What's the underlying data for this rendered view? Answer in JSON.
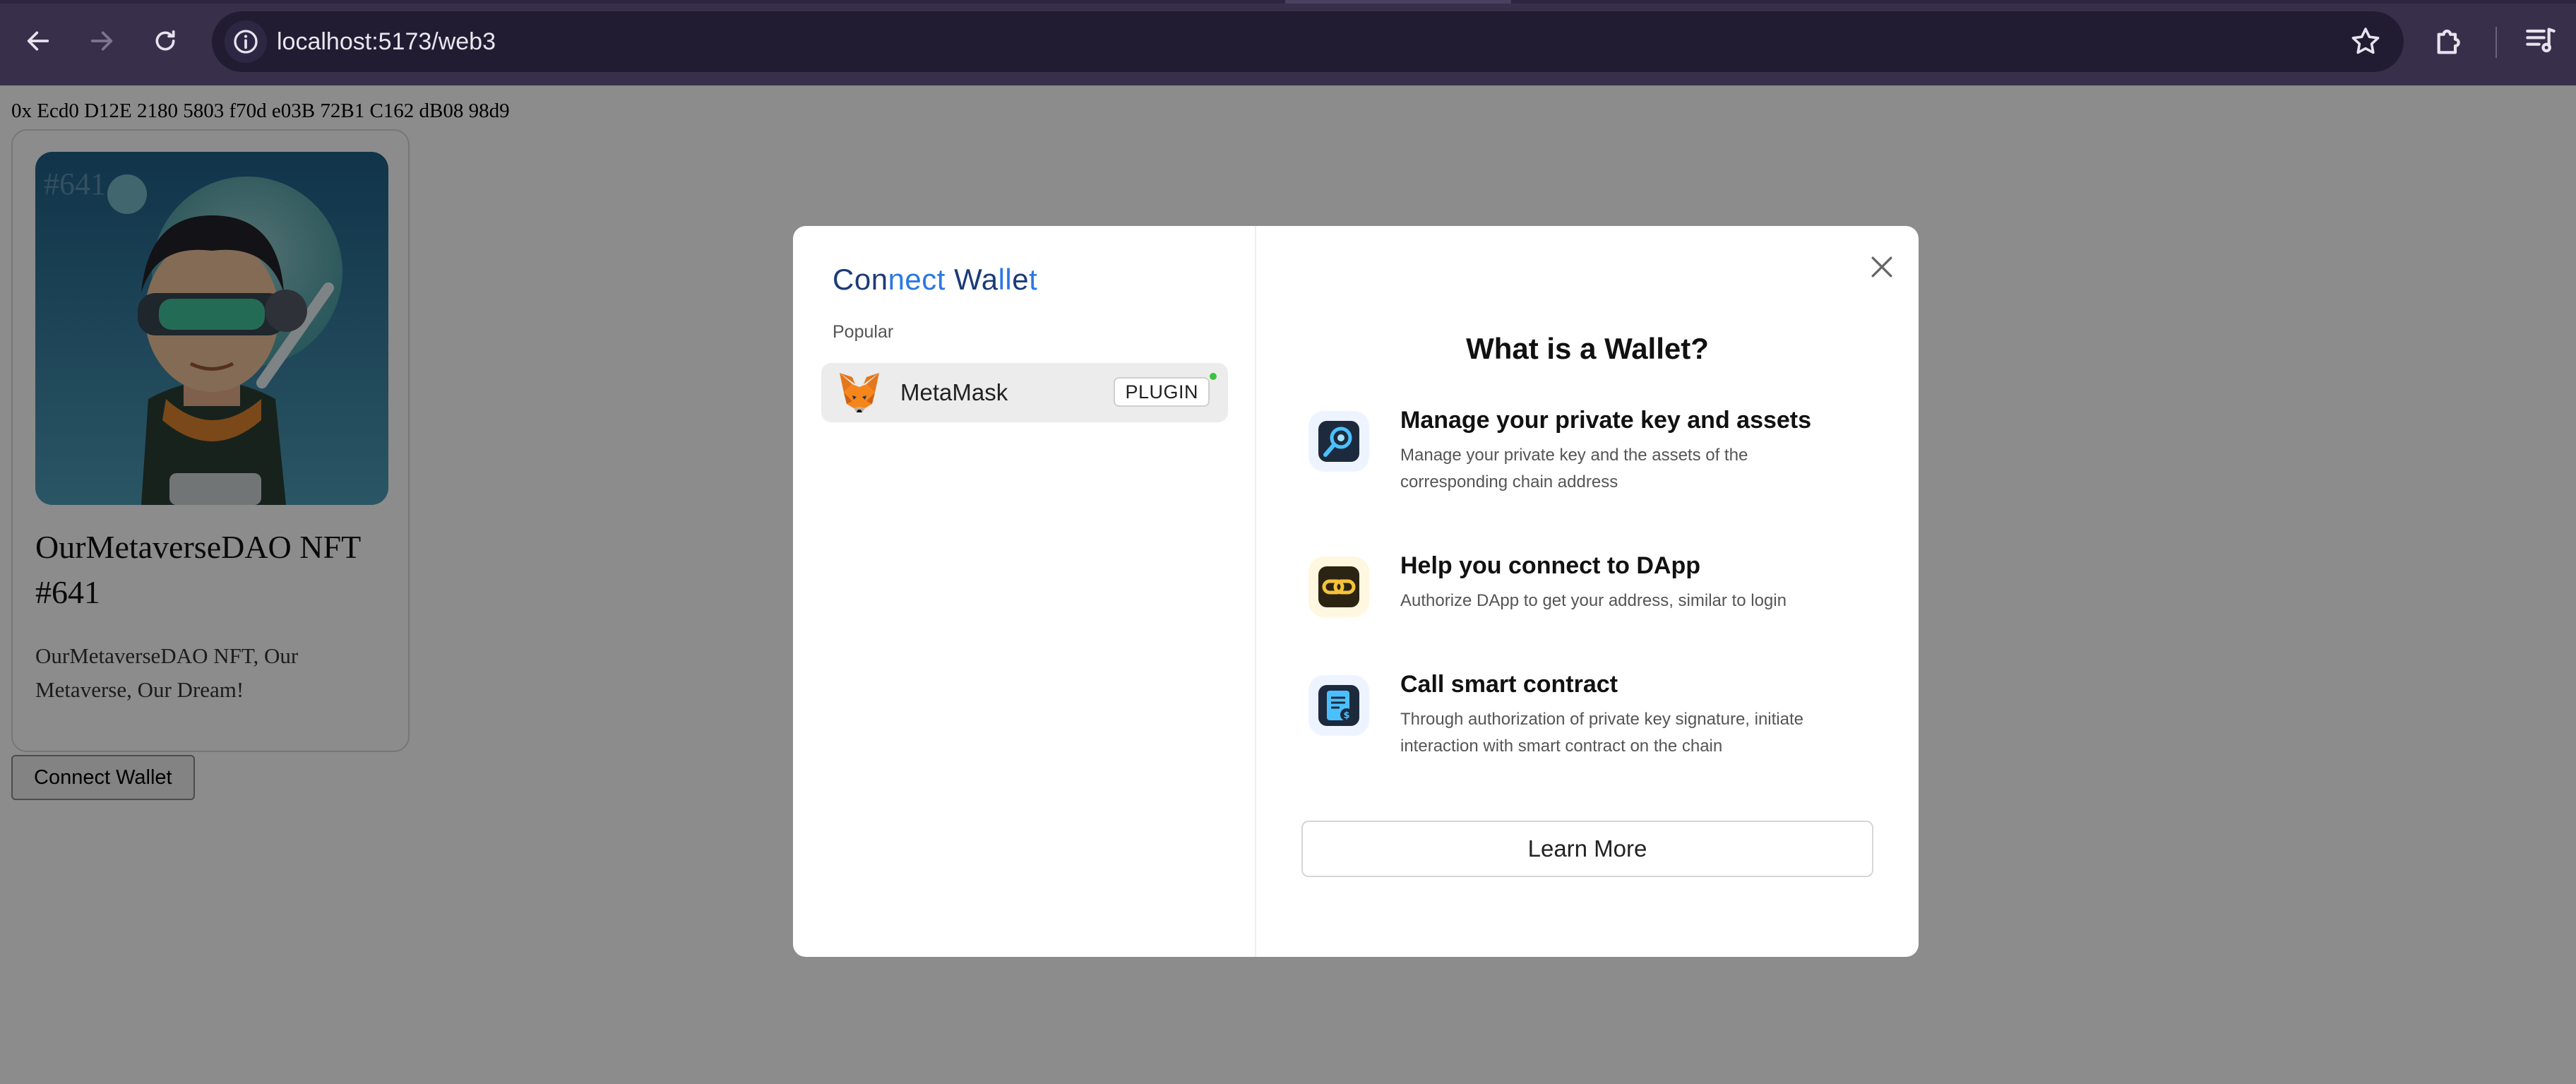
{
  "browser": {
    "url": "localhost:5173/web3",
    "icons": {
      "back": "arrow-left-icon",
      "forward": "arrow-right-icon",
      "reload": "reload-icon",
      "site_info": "site-info-icon",
      "bookmark": "star-icon",
      "extensions": "puzzle-icon",
      "media": "media-controls-icon"
    }
  },
  "page": {
    "address": "0x Ecd0 D12E 2180 5803 f70d e03B 72B1 C162 dB08 98d9",
    "nft": {
      "badge_text": "#641",
      "title": "OurMetaverseDAO NFT #641",
      "description": "OurMetaverseDAO NFT, Our Metaverse, Our Dream!"
    },
    "connect_button": "Connect Wallet"
  },
  "modal": {
    "title_parts": [
      "Con",
      "nect",
      " Wa",
      "ll",
      "e",
      "t"
    ],
    "group_label": "Popular",
    "wallets": [
      {
        "name": "MetaMask",
        "badge": "PLUGIN",
        "status": "online",
        "icon": "metamask-fox-icon"
      }
    ],
    "info_title": "What is a Wallet?",
    "features": [
      {
        "icon": "key-search-icon",
        "title": "Manage your private key and assets",
        "desc": "Manage your private key and the assets of the corresponding chain address"
      },
      {
        "icon": "link-icon",
        "title": "Help you connect to DApp",
        "desc": "Authorize DApp to get your address, similar to login"
      },
      {
        "icon": "contract-icon",
        "title": "Call smart contract",
        "desc": "Through authorization of private key signature, initiate interaction with smart contract on the chain"
      }
    ],
    "learn_more": "Learn More",
    "colors": {
      "title_dark": "#1c3b78",
      "title_accent": "#2a78e4",
      "online": "#3bc43b"
    }
  }
}
